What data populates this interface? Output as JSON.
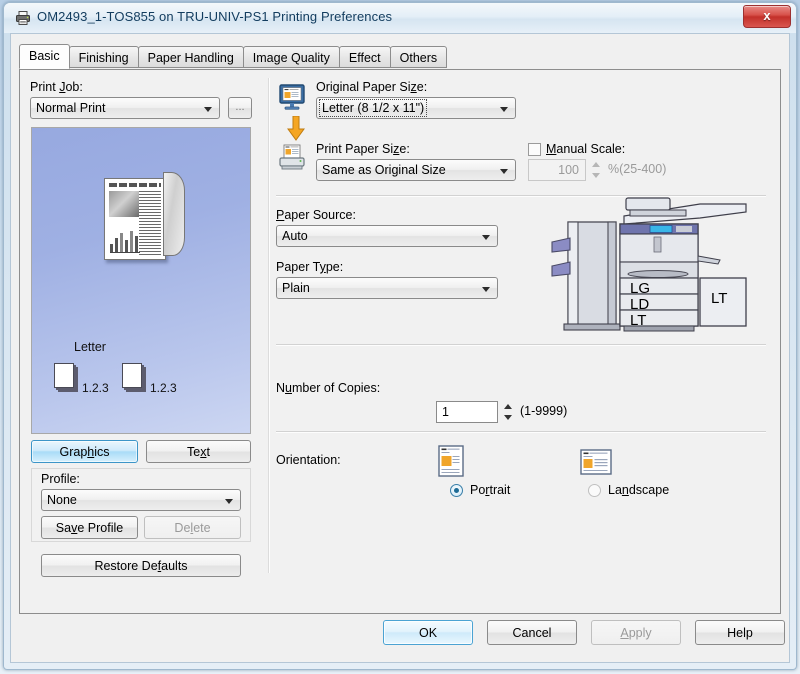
{
  "window": {
    "title": "OM2493_1-TOS855 on TRU-UNIV-PS1 Printing Preferences",
    "icon": "printer-icon",
    "close_label": "x",
    "accent_blue": "#4ba3d3",
    "close_red": "#c3302a"
  },
  "tabs": [
    {
      "label": "Basic",
      "active": true
    },
    {
      "label": "Finishing",
      "active": false
    },
    {
      "label": "Paper Handling",
      "active": false
    },
    {
      "label": "Image Quality",
      "active": false
    },
    {
      "label": "Effect",
      "active": false
    },
    {
      "label": "Others",
      "active": false
    }
  ],
  "left_panel": {
    "print_job_label": "Print Job:",
    "print_job_value": "Normal Print",
    "ellipsis_button": "...",
    "preview": {
      "paper_label": "Letter",
      "copy_marker_1": "1.2.3",
      "copy_marker_2": "1.2.3"
    },
    "graphics_button": "Graphics",
    "text_button": "Text",
    "profile_label": "Profile:",
    "profile_value": "None",
    "save_profile_button": "Save Profile",
    "delete_button": "Delete",
    "restore_defaults_button": "Restore Defaults"
  },
  "right_panel": {
    "original_paper_size_label": "Original Paper Size:",
    "original_paper_size_value": "Letter (8 1/2 x 11\")",
    "print_paper_size_label": "Print Paper Size:",
    "print_paper_size_value": "Same as Original Size",
    "manual_scale_label": "Manual Scale:",
    "manual_scale_checked": false,
    "manual_scale_value": "100",
    "manual_scale_range": "%(25-400)",
    "paper_source_label": "Paper Source:",
    "paper_source_value": "Auto",
    "paper_type_label": "Paper Type:",
    "paper_type_value": "Plain",
    "printer_trays": {
      "tray_1": "LG",
      "tray_2": "LD",
      "tray_3": "LT",
      "bypass": "LT"
    },
    "copies_label": "Number of Copies:",
    "copies_value": "1",
    "copies_range": "(1-9999)",
    "orientation_label": "Orientation:",
    "orientation_portrait": "Portrait",
    "orientation_landscape": "Landscape",
    "orientation_selected": "Portrait"
  },
  "footer": {
    "ok_button": "OK",
    "cancel_button": "Cancel",
    "apply_button": "Apply",
    "apply_disabled": true,
    "help_button": "Help"
  }
}
